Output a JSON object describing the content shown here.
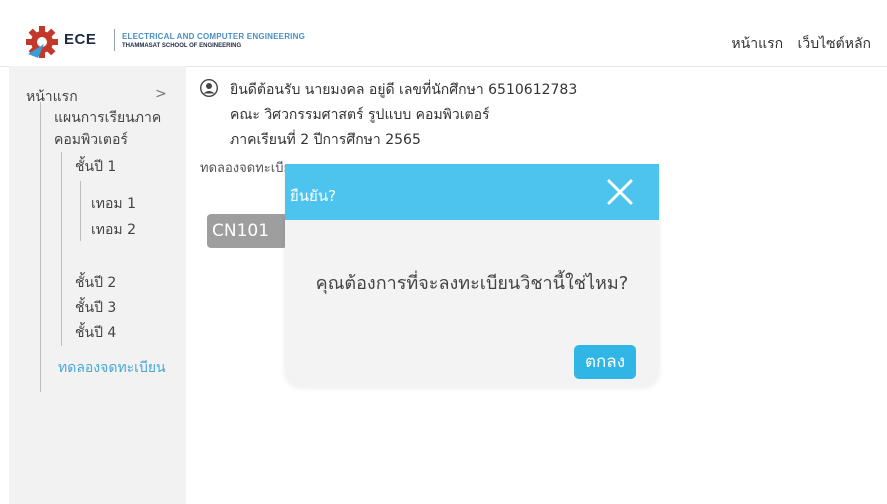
{
  "header": {
    "logo_text": "ECE",
    "logo_line1": "ELECTRICAL AND COMPUTER ENGINEERING",
    "logo_line2": "THAMMASAT SCHOOL OF ENGINEERING",
    "nav": [
      "หน้าแรก",
      "เว็บไซต์หลัก"
    ]
  },
  "sidebar": {
    "home": "หน้าแรก",
    "chevron": ">",
    "plan_line1": "แผนการเรียนภาค",
    "plan_line2": "คอมพิวเตอร์",
    "year1": "ชั้นปี 1",
    "term1": "เทอม 1",
    "term2": "เทอม 2",
    "year2": "ชั้นปี 2",
    "year3": "ชั้นปี 3",
    "year4": "ชั้นปี 4",
    "try_register": "ทดลองจดทะเบียน"
  },
  "main": {
    "welcome": "ยินดีต้อนรับ นายมงคล อยู่ดี เลขที่นักศึกษา 6510612783",
    "faculty": "คณะ วิศวกรรมศาสตร์ รูปแบบ คอมพิวเตอร์",
    "semester": "ภาคเรียนที่ 2 ปีการศึกษา 2565",
    "register_title": "ทดลองจดทะเบียน",
    "course_code": "CN101"
  },
  "modal": {
    "title": "ยืนยัน?",
    "message": "คุณต้องการที่จะลงทะเบียนวิชานี้ใช่ไหม?",
    "ok_label": "ตกลง"
  },
  "colors": {
    "accent": "#4cc4ee",
    "ok_button": "#30b6e6",
    "sidebar_bg": "#f2f2f2",
    "link": "#4aa6d8",
    "logo_red": "#c0392b"
  },
  "icons": {
    "logo": "gear-logo-icon",
    "user": "user-icon",
    "close": "close-icon"
  }
}
